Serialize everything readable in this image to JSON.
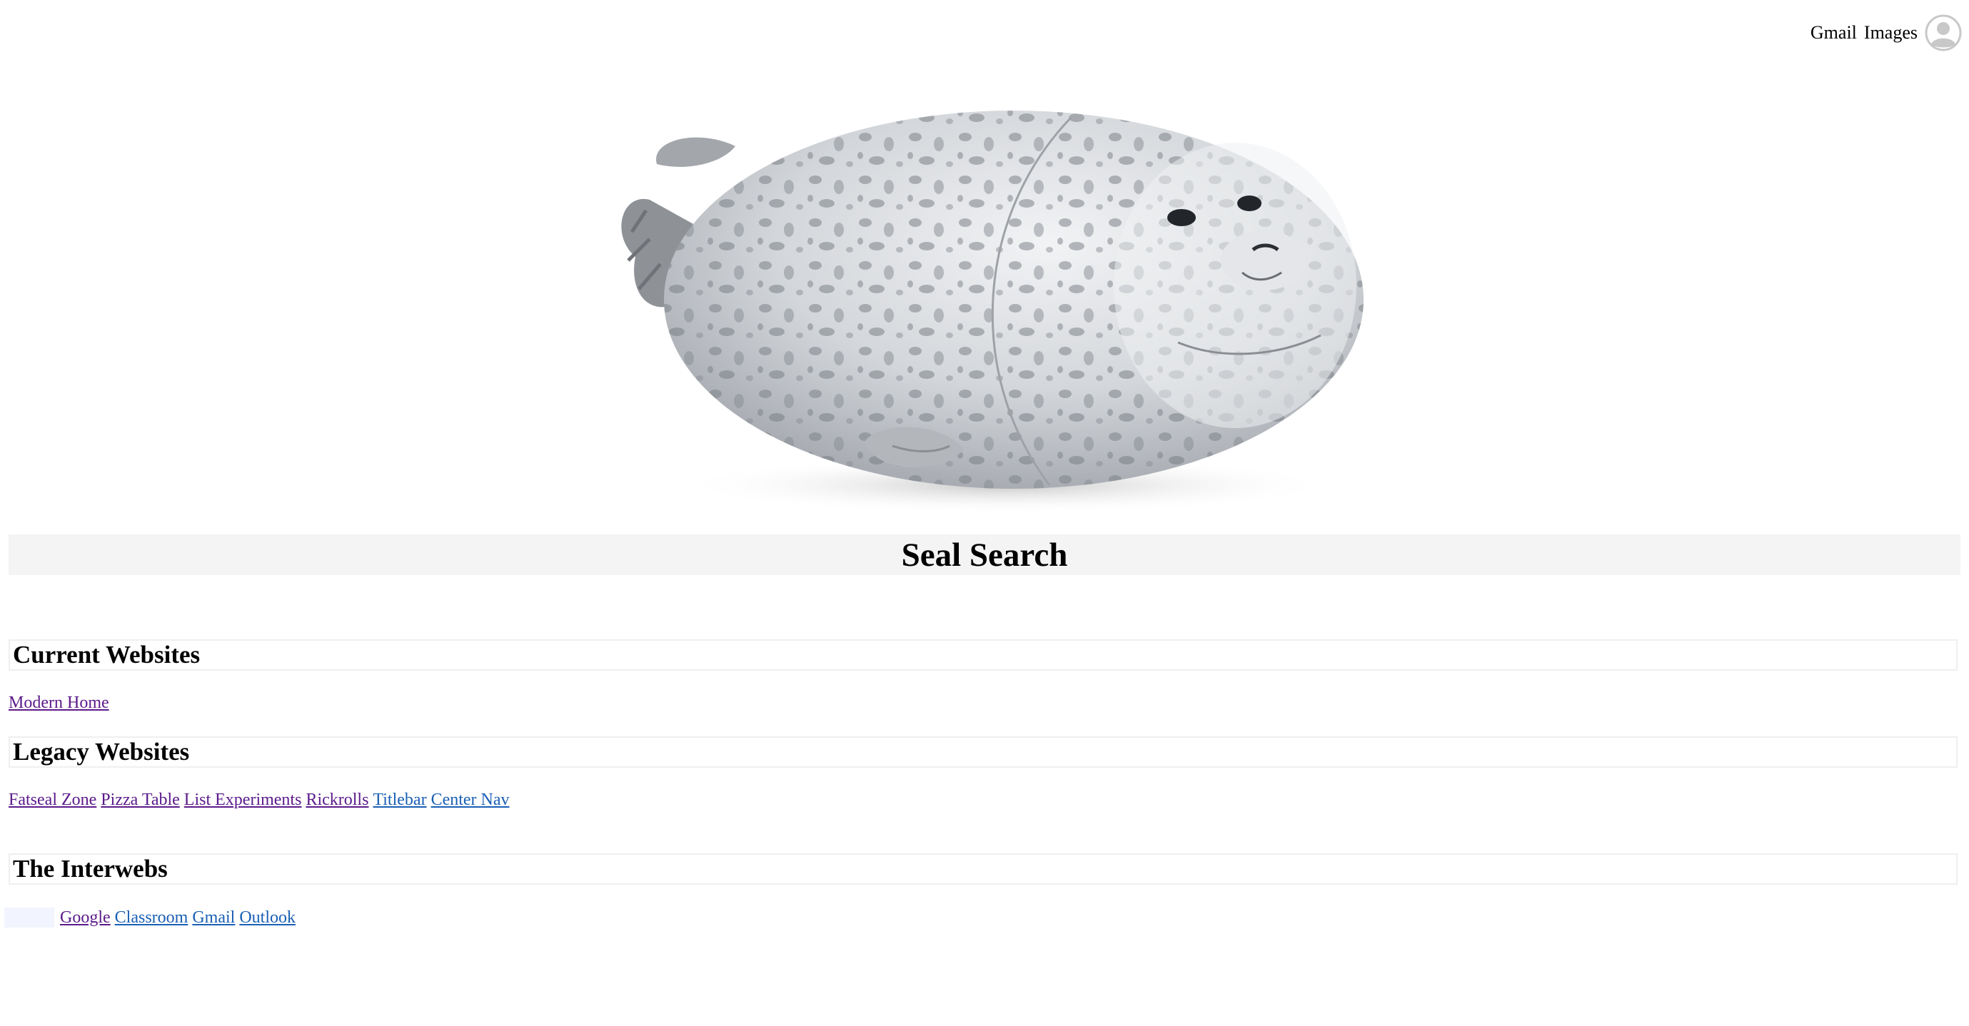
{
  "topbar": {
    "gmail": "Gmail",
    "images": "Images",
    "avatar_icon": "account-circle-icon"
  },
  "hero": {
    "image_icon": "seal-plush-image"
  },
  "page": {
    "title": "Seal Search"
  },
  "current": {
    "heading": "Current Websites",
    "links": [
      "Modern Home"
    ]
  },
  "legacy": {
    "heading": "Legacy Websites",
    "links": [
      "Fatseal Zone",
      "Pizza Table",
      "List Experiments",
      "Rickrolls",
      "Titlebar",
      "Center Nav"
    ]
  },
  "interwebs": {
    "heading": "The Interwebs",
    "links": [
      "Google",
      "Classroom",
      "Gmail",
      "Outlook"
    ]
  },
  "colors": {
    "visited_link": "#5b1a8a",
    "unvisited_link": "#1a5fb4",
    "title_bg": "#f4f4f4"
  }
}
